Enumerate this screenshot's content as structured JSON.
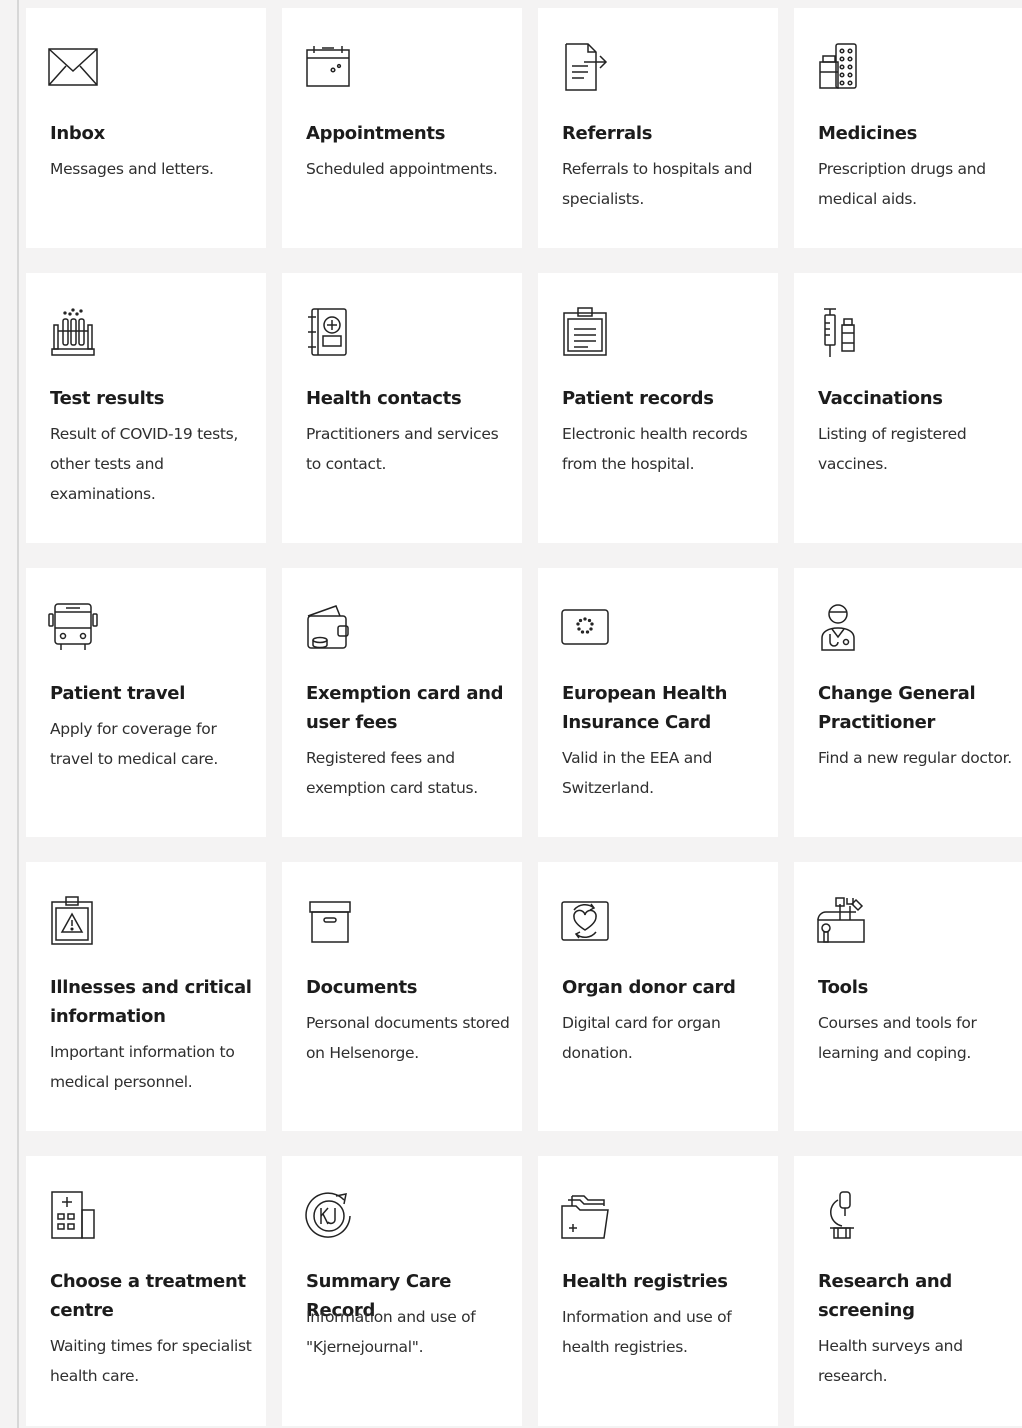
{
  "cards": [
    {
      "title": "Inbox",
      "desc": "Messages and letters.",
      "icon": "envelope-icon"
    },
    {
      "title": "Appointments",
      "desc": "Scheduled appointments.",
      "icon": "calendar-icon"
    },
    {
      "title": "Referrals",
      "desc": "Referrals to hospitals and specialists.",
      "icon": "document-arrow-icon"
    },
    {
      "title": "Medicines",
      "desc": "Prescription drugs and medical aids.",
      "icon": "pill-box-icon"
    },
    {
      "title": "Test results",
      "desc": "Result of COVID-19 tests, other tests and examinations.",
      "icon": "test-tubes-icon"
    },
    {
      "title": "Health contacts",
      "desc": "Practitioners and services to contact.",
      "icon": "contact-book-icon"
    },
    {
      "title": "Patient records",
      "desc": "Electronic health records from the hospital.",
      "icon": "clipboard-icon"
    },
    {
      "title": "Vaccinations",
      "desc": "Listing of registered vaccines.",
      "icon": "syringe-vial-icon"
    },
    {
      "title": "Patient travel",
      "desc": "Apply for coverage for travel to medical care.",
      "icon": "bus-icon"
    },
    {
      "title": "Exemption card and user fees",
      "desc": "Registered fees and exemption card status.",
      "icon": "wallet-icon"
    },
    {
      "title": "European Health Insurance Card",
      "desc": "Valid in the EEA and Switzerland.",
      "icon": "eu-card-icon"
    },
    {
      "title": "Change General Practitioner",
      "desc": "Find a new regular doctor.",
      "icon": "doctor-icon"
    },
    {
      "title": "Illnesses and critical information",
      "desc": "Important information to medical personnel.",
      "icon": "warning-clipboard-icon"
    },
    {
      "title": "Documents",
      "desc": "Personal documents stored on Helsenorge.",
      "icon": "archive-box-icon"
    },
    {
      "title": "Organ donor card",
      "desc": "Digital card for organ donation.",
      "icon": "heart-card-icon"
    },
    {
      "title": "Tools",
      "desc": "Courses and tools for learning and coping.",
      "icon": "toolbox-icon"
    },
    {
      "title": "Choose a treatment centre",
      "desc": "Waiting times for specialist health care.",
      "icon": "hospital-icon"
    },
    {
      "title": "Summary Care Record",
      "desc": "Information and use of \"Kjernejournal\".",
      "icon": "kj-logo-icon"
    },
    {
      "title": "Health registries",
      "desc": "Information and use of health registries.",
      "icon": "folder-plus-icon"
    },
    {
      "title": "Research and screening",
      "desc": "Health surveys and research.",
      "icon": "microscope-icon"
    }
  ]
}
